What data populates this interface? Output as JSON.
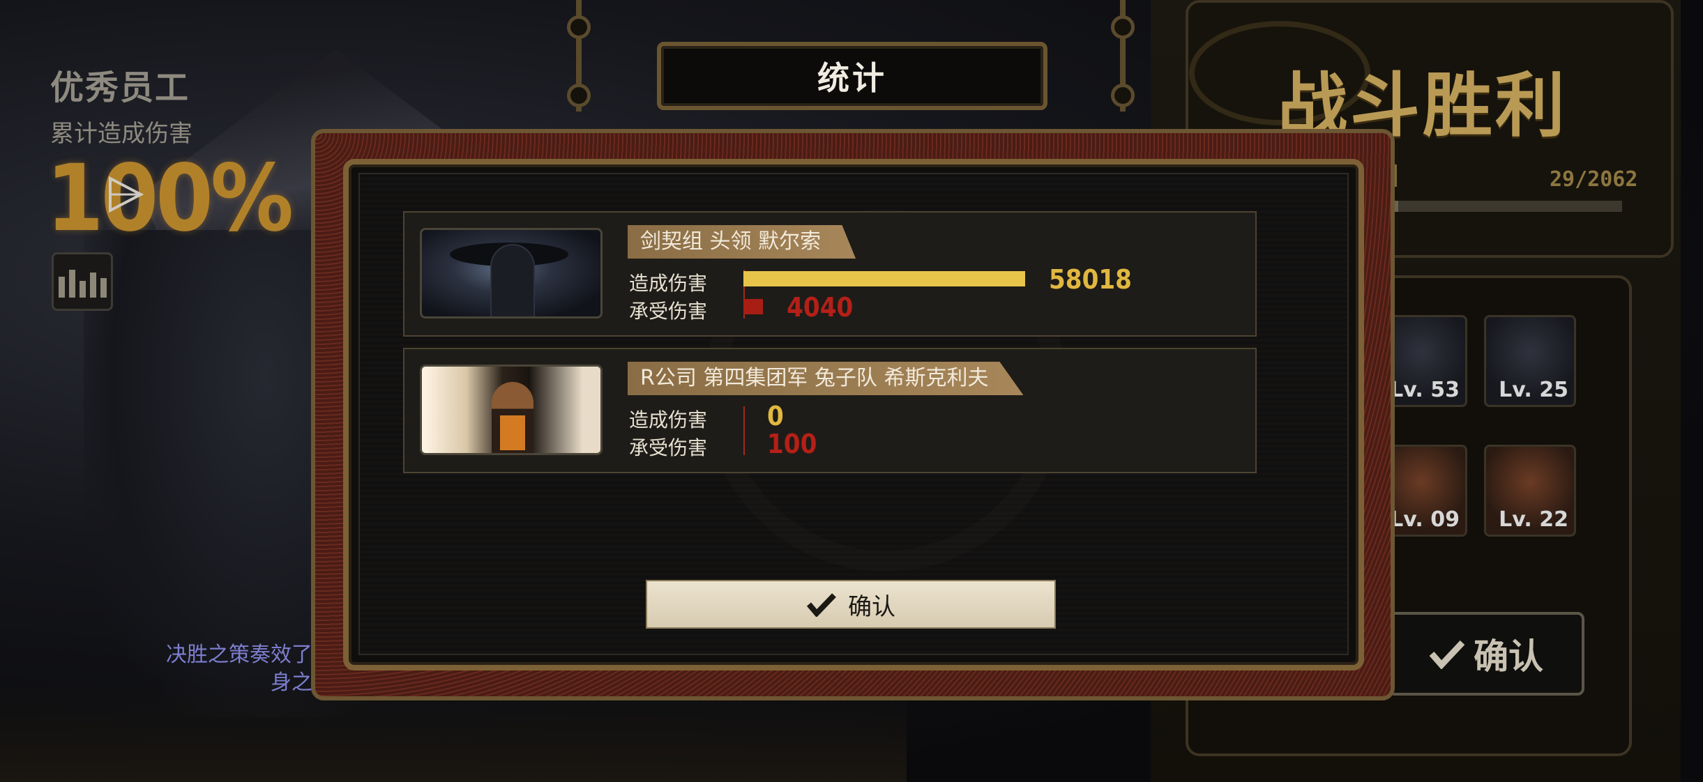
{
  "left_stats": {
    "title": "优秀员工",
    "subtitle": "累计造成伤害",
    "percent": "100%",
    "skill_message": "决胜之策奏效了\n身之"
  },
  "header": {
    "title": "统计"
  },
  "right_panel": {
    "victory_title": "战斗胜利",
    "progress_text": "29/2062",
    "progress_value": 0.014,
    "portraits": [
      {
        "level": "Lv. 53"
      },
      {
        "level": "Lv. 25"
      },
      {
        "level": "Lv. 09"
      },
      {
        "level": "Lv. 22"
      }
    ],
    "confirm_label": "确认"
  },
  "cards": [
    {
      "name": "剑契组 头领 默尔索",
      "dealt_label": "造成伤害",
      "taken_label": "承受伤害",
      "dealt": 58018,
      "taken": 4040,
      "dealt_text": "58018",
      "taken_text": "4040"
    },
    {
      "name": "R公司 第四集团军 兔子队 希斯克利夫",
      "dealt_label": "造成伤害",
      "taken_label": "承受伤害",
      "dealt": 0,
      "taken": 100,
      "dealt_text": "0",
      "taken_text": "100"
    }
  ],
  "confirm_label": "确认",
  "colors": {
    "dealt_bar": "#e7c44a",
    "taken_bar": "#a81e14",
    "accent_gold": "#b1812a"
  },
  "icons": [
    "play-icon",
    "stats-icon",
    "check-icon"
  ]
}
